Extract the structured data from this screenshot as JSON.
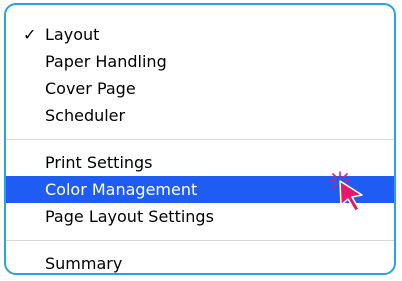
{
  "menu": {
    "group1": [
      {
        "label": "Layout",
        "checked": true
      },
      {
        "label": "Paper Handling"
      },
      {
        "label": "Cover Page"
      },
      {
        "label": "Scheduler"
      }
    ],
    "group2": [
      {
        "label": "Print Settings"
      },
      {
        "label": "Color Management",
        "selected": true
      },
      {
        "label": "Page Layout Settings"
      }
    ],
    "group3": [
      {
        "label": "Summary"
      }
    ],
    "checkmark": "✓"
  },
  "colors": {
    "frame_border": "#2aa3dd",
    "selection": "#1f5cf4",
    "cursor": "#e8176b"
  },
  "cursor_icon": "pointer-arrow-click-icon"
}
